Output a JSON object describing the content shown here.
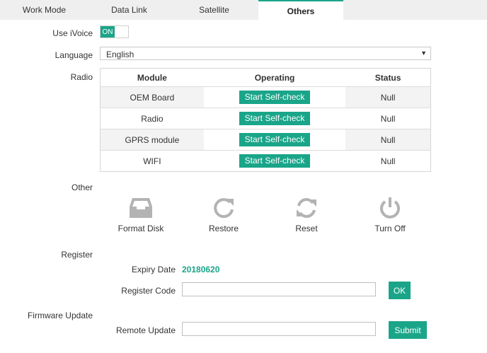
{
  "tabs": [
    {
      "label": "Work Mode"
    },
    {
      "label": "Data Link"
    },
    {
      "label": "Satellite"
    },
    {
      "label": "Others"
    }
  ],
  "ivoice": {
    "label": "Use iVoice",
    "state": "ON"
  },
  "language": {
    "label": "Language",
    "value": "English"
  },
  "radio": {
    "label": "Radio",
    "headers": [
      "Module",
      "Operating",
      "Status"
    ],
    "rows": [
      {
        "module": "OEM Board",
        "action": "Start Self-check",
        "status": "Null"
      },
      {
        "module": "Radio",
        "action": "Start Self-check",
        "status": "Null"
      },
      {
        "module": "GPRS module",
        "action": "Start Self-check",
        "status": "Null"
      },
      {
        "module": "WIFI",
        "action": "Start Self-check",
        "status": "Null"
      }
    ]
  },
  "other": {
    "label": "Other",
    "ops": [
      {
        "label": "Format Disk",
        "icon": "format-disk-icon"
      },
      {
        "label": "Restore",
        "icon": "restore-icon"
      },
      {
        "label": "Reset",
        "icon": "reset-icon"
      },
      {
        "label": "Turn Off",
        "icon": "power-icon"
      }
    ]
  },
  "register": {
    "label": "Register",
    "expiry_label": "Expiry Date",
    "expiry_value": "20180620",
    "code_label": "Register Code",
    "code_value": "",
    "ok_label": "OK"
  },
  "firmware": {
    "label": "Firmware Update",
    "remote_label": "Remote Update",
    "remote_value": "",
    "submit_label": "Submit"
  },
  "colors": {
    "accent": "#1aa589",
    "icon_gray": "#b3b3b3",
    "tab_bg": "#efefef"
  }
}
